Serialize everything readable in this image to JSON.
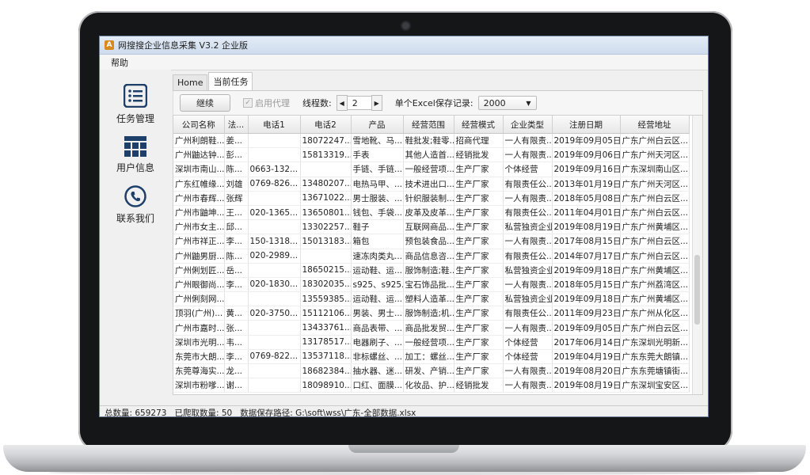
{
  "window": {
    "title": "网搜搜企业信息采集 V3.2 企业版",
    "icon_letter": "A"
  },
  "menu": {
    "items": [
      "帮助"
    ]
  },
  "sidebar": {
    "items": [
      {
        "label": "任务管理",
        "icon": "task-list-icon"
      },
      {
        "label": "用户信息",
        "icon": "grid-icon"
      },
      {
        "label": "联系我们",
        "icon": "phone-icon"
      }
    ]
  },
  "tabs": [
    {
      "label": "Home",
      "active": false
    },
    {
      "label": "当前任务",
      "active": true
    }
  ],
  "toolbar": {
    "continue_label": "继续",
    "proxy_label": "启用代理",
    "threads_label": "线程数:",
    "threads_value": "2",
    "excel_label": "单个Excel保存记录:",
    "excel_value": "2000"
  },
  "table": {
    "columns": [
      "公司名称",
      "法...",
      "电话1",
      "电话2",
      "产品",
      "经营范围",
      "经营模式",
      "企业类型",
      "注册日期",
      "经营地址"
    ],
    "rows": [
      [
        "广州利朗鞋...",
        "姜...",
        "",
        "18072247...",
        "雪地靴、马...",
        "鞋批发;鞋零...",
        "招商代理",
        "一人有限责...",
        "2019年09月05日",
        "广东广州白云区..."
      ],
      [
        "广州鼬达钟...",
        "彭...",
        "",
        "15813319...",
        "手表",
        "其他人造首...",
        "经销批发",
        "一人有限责...",
        "2019年09月06日",
        "广东广州天河区..."
      ],
      [
        "深圳市南山...",
        "陈...",
        "0663-132...",
        "",
        "手链、手链...",
        "一般经营项...",
        "生产厂家",
        "个体经营",
        "2019年09月16日",
        "广东深圳南山区..."
      ],
      [
        "广东红帷缘...",
        "刘雄",
        "0769-826...",
        "13480207...",
        "电热马甲、...",
        "技术进出口...",
        "生产厂家",
        "有限责任公...",
        "2013年01月19日",
        "广东广州天河区..."
      ],
      [
        "广州市春辉...",
        "张辉",
        "",
        "13671022...",
        "男士服装、...",
        "针织服装制...",
        "生产厂家",
        "一人有限责...",
        "2018年05月08日",
        "广东广州白云区..."
      ],
      [
        "广州市鼬坤...",
        "王...",
        "020-1365...",
        "13650801...",
        "钱包、手袋...",
        "皮革及皮革...",
        "生产厂家",
        "有限责任公...",
        "2011年04月01日",
        "广东广州白云区..."
      ],
      [
        "广州市女主...",
        "邱...",
        "",
        "13302257...",
        "鞋子",
        "互联网商品...",
        "生产厂家",
        "私营独资企业",
        "2019年08月19日",
        "广东广州黄埔区..."
      ],
      [
        "广州市祥正...",
        "李...",
        "150-1318...",
        "15013183...",
        "箱包",
        "预包装食品...",
        "生产厂家",
        "一人有限责...",
        "2017年08月15日",
        "广东广州白云区..."
      ],
      [
        "广州鼬男厨...",
        "陈...",
        "020-2989...",
        "",
        "速冻肉类丸...",
        "商品信息咨...",
        "生产厂家",
        "有限责任公...",
        "2014年07月17日",
        "广东广州白云区..."
      ],
      [
        "广州俐划匠...",
        "岳...",
        "",
        "18650215...",
        "运动鞋、运...",
        "服饰制造;鞋...",
        "生产厂家",
        "私营独资企业",
        "2019年09月18日",
        "广东广州黄埔区..."
      ],
      [
        "广州眼御尚...",
        "李...",
        "020-1830...",
        "18302035...",
        "s925、s925...",
        "宝石饰品批...",
        "生产厂家",
        "一人有限责...",
        "2018年05月15日",
        "广东广州荔湾区..."
      ],
      [
        "广州俐刻网...",
        "",
        "",
        "13559385...",
        "运动鞋、运...",
        "塑料人造革...",
        "生产厂家",
        "私营独资企业",
        "2019年09月18日",
        "广东广州黄埔区..."
      ],
      [
        "顶羽(广州)...",
        "黄...",
        "020-3750...",
        "15112106...",
        "男装、男士...",
        "服饰制造;机...",
        "生产厂家",
        "有限责任公...",
        "2011年09月23日",
        "广东广州从化区..."
      ],
      [
        "广州市嘉时...",
        "张...",
        "",
        "13433761...",
        "商品表带、...",
        "商品批发贸...",
        "生产厂家",
        "一人有限责...",
        "2019年09月05日",
        "广东广州白云区..."
      ],
      [
        "深圳市光明...",
        "韦...",
        "",
        "13178517...",
        "电器刷子、...",
        "一般经营项...",
        "生产厂家",
        "个体经营",
        "2017年06月14日",
        "广东深圳光明新..."
      ],
      [
        "东莞市大朗...",
        "李...",
        "0769-822...",
        "13537118...",
        "非标螺丝、...",
        "加工：螺丝...",
        "生产厂家",
        "个体经营",
        "2019年04月19日",
        "广东东莞大朗镇..."
      ],
      [
        "东莞尊海实...",
        "龙...",
        "",
        "18682384...",
        "抽水器、迷...",
        "研发、产销...",
        "生产厂家",
        "一人有限责...",
        "2019年08月20日",
        "广东东莞塘镇街..."
      ],
      [
        "深圳市粉嗲...",
        "谢...",
        "",
        "18098910...",
        "口红、面膜...",
        "化妆品、护...",
        "经销批发",
        "一人有限责...",
        "2019年08月19日",
        "广东深圳宝安区..."
      ]
    ]
  },
  "status": {
    "total": "总数量: 659273",
    "crawled": "已爬取数量: 50",
    "path": "数据保存路径: G:\\soft\\wss\\广东-全部数据.xlsx"
  },
  "colors": {
    "title_bar": "#d9e5f3",
    "window_bg": "#f0f0f0",
    "icon_blue": "#1f3f6b"
  }
}
